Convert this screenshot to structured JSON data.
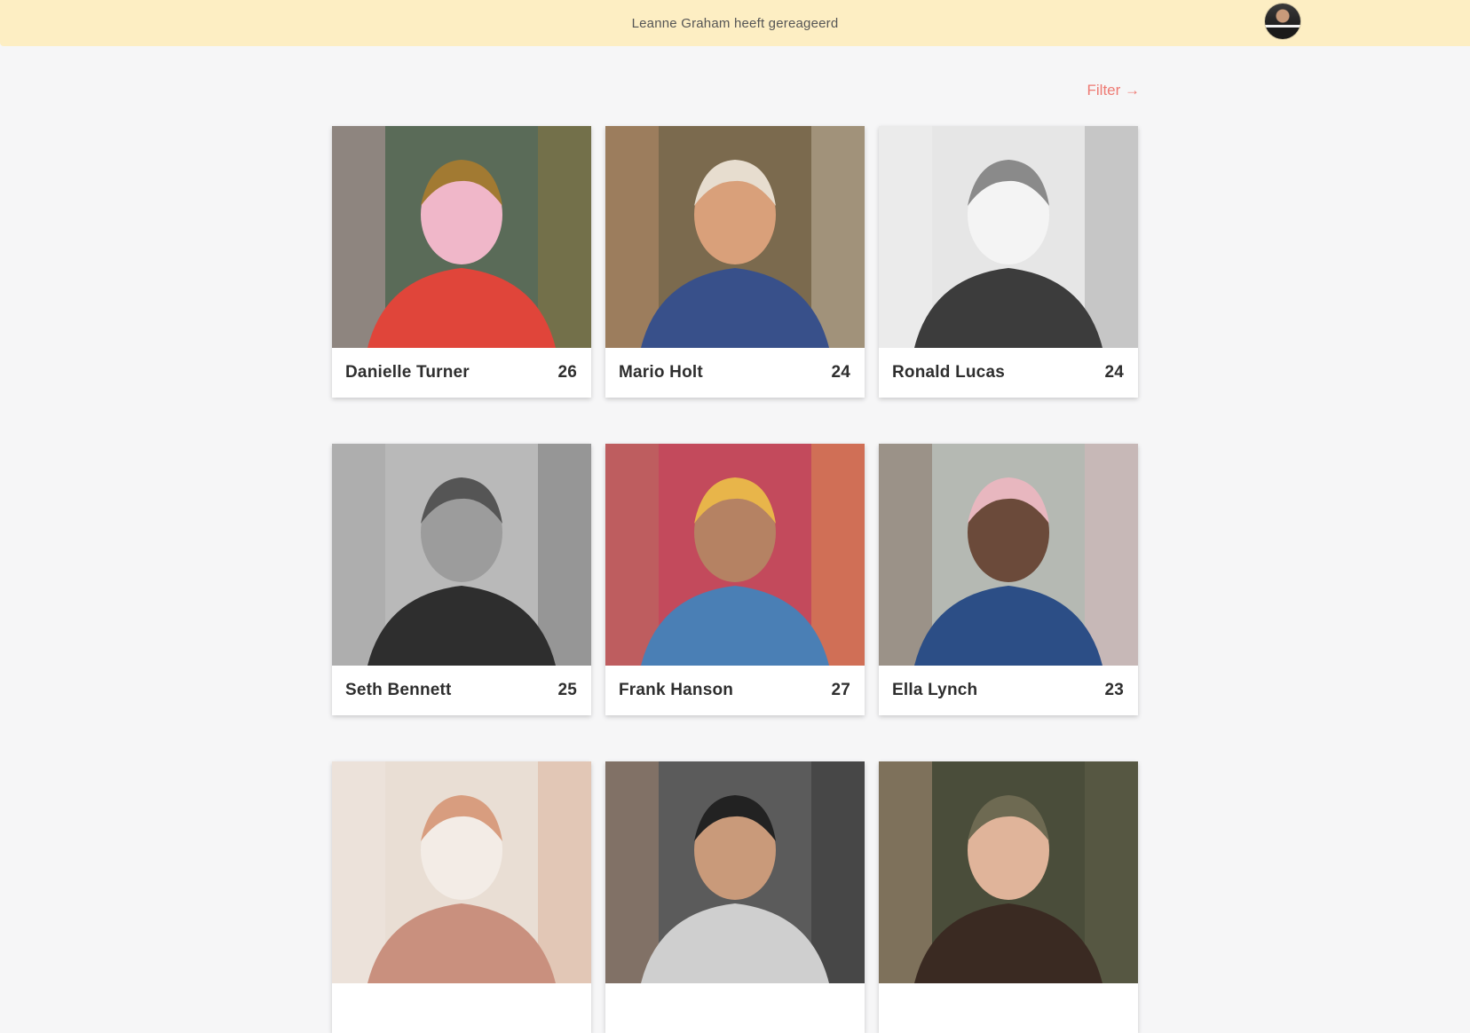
{
  "notification": {
    "text": "Leanne Graham heeft gereageerd",
    "avatar_icon": "user-avatar"
  },
  "filter": {
    "label": "Filter →"
  },
  "profiles": [
    {
      "name": "Danielle Turner",
      "age": "26",
      "photo_colors": [
        "#5a6b58",
        "#e0453a",
        "#f0b7c9",
        "#a27a32"
      ]
    },
    {
      "name": "Mario Holt",
      "age": "24",
      "photo_colors": [
        "#7b6a4e",
        "#38508a",
        "#d9a07a",
        "#e7ddcf"
      ]
    },
    {
      "name": "Ronald Lucas",
      "age": "24",
      "photo_colors": [
        "#e6e6e6",
        "#3c3c3c",
        "#f4f4f4",
        "#8a8a8a"
      ]
    },
    {
      "name": "Seth Bennett",
      "age": "25",
      "photo_colors": [
        "#b9b9b9",
        "#2e2e2e",
        "#9c9c9c",
        "#555555"
      ]
    },
    {
      "name": "Frank Hanson",
      "age": "27",
      "photo_colors": [
        "#c34a5c",
        "#4a7fb5",
        "#b58263",
        "#e8b54a"
      ]
    },
    {
      "name": "Ella Lynch",
      "age": "23",
      "photo_colors": [
        "#b5b9b3",
        "#2c4e86",
        "#6b4a3a",
        "#e8b7bf"
      ]
    },
    {
      "name": "",
      "age": "",
      "photo_colors": [
        "#e9ded4",
        "#c9907e",
        "#f3ece6",
        "#d89d7f"
      ]
    },
    {
      "name": "",
      "age": "",
      "photo_colors": [
        "#5b5b5b",
        "#cfcfcf",
        "#c99a7a",
        "#222222"
      ]
    },
    {
      "name": "",
      "age": "",
      "photo_colors": [
        "#4a4d3a",
        "#3a2a22",
        "#e0b49a",
        "#6e6a52"
      ]
    }
  ]
}
